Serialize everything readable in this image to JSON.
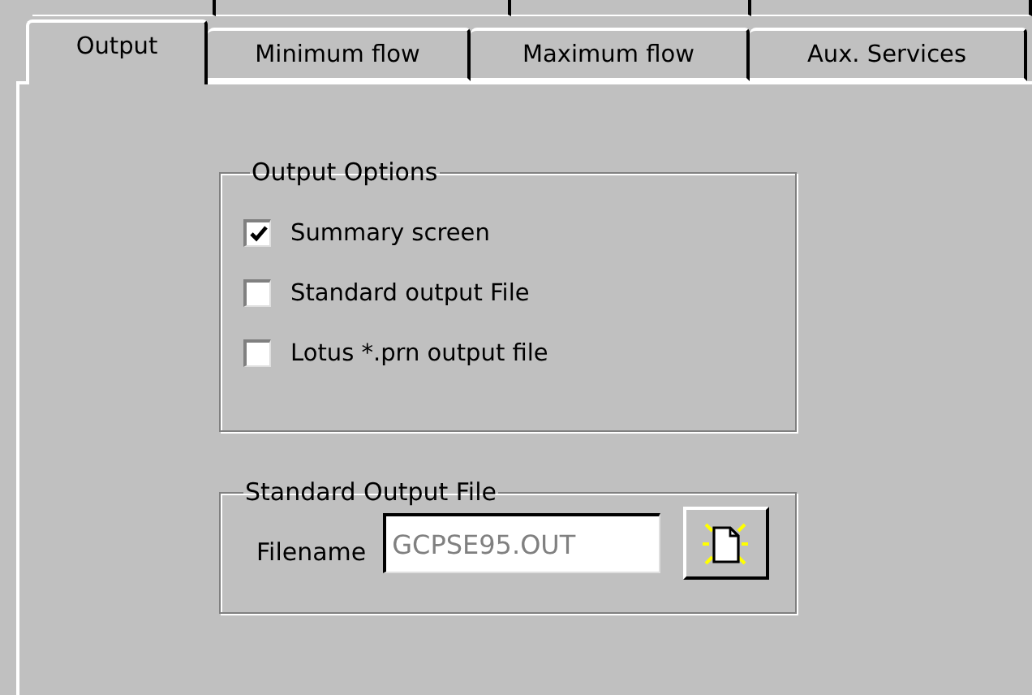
{
  "tabs": [
    {
      "label": "Output",
      "selected": true
    },
    {
      "label": "Minimum flow",
      "selected": false
    },
    {
      "label": "Maximum flow",
      "selected": false
    },
    {
      "label": "Aux. Services",
      "selected": false
    }
  ],
  "output_options": {
    "title": "Output Options",
    "options": [
      {
        "label": "Summary screen",
        "checked": true
      },
      {
        "label": "Standard output File",
        "checked": false
      },
      {
        "label": "Lotus *.prn output file",
        "checked": false
      }
    ]
  },
  "standard_output_file": {
    "title": "Standard Output File",
    "filename_label": "Filename",
    "filename_value": "GCPSE95.OUT",
    "disabled": true
  }
}
